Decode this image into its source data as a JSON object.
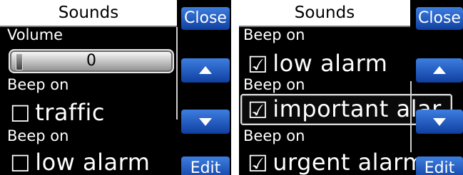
{
  "left": {
    "title": "Sounds",
    "buttons": {
      "close": "Close",
      "edit": "Edit"
    },
    "volume": {
      "label": "Volume",
      "value": "0"
    },
    "items": [
      {
        "label": "Beep on",
        "text": "traffic",
        "checked": false
      },
      {
        "label": "Beep on",
        "text": "low alarm",
        "checked": false
      }
    ]
  },
  "right": {
    "title": "Sounds",
    "buttons": {
      "close": "Close",
      "edit": "Edit"
    },
    "top_label": "Beep on",
    "items": [
      {
        "label": "",
        "text": "low alarm",
        "checked": true
      },
      {
        "label": "Beep on",
        "text": "important alar.",
        "checked": true,
        "selected": true
      },
      {
        "label": "Beep on",
        "text": "urgent alarm",
        "checked": true
      }
    ]
  },
  "glyphs": {
    "checkbox_checked": "☑",
    "checkbox_unchecked": "☐"
  }
}
